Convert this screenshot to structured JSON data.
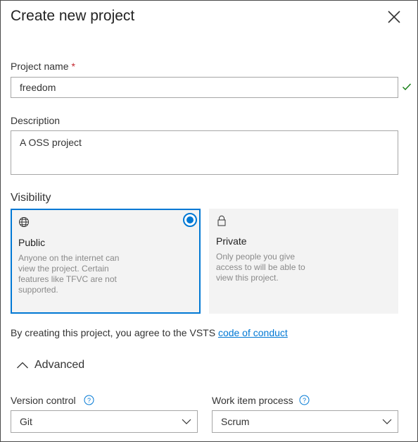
{
  "dialog": {
    "title": "Create new project",
    "close_icon": "close-icon"
  },
  "project_name": {
    "label": "Project name",
    "required_marker": "*",
    "value": "freedom",
    "valid_icon": "checkmark-icon"
  },
  "description": {
    "label": "Description",
    "value": "A OSS project"
  },
  "visibility": {
    "label": "Visibility",
    "options": [
      {
        "icon": "globe-icon",
        "title": "Public",
        "description": "Anyone on the internet can view the project. Certain features like TFVC are not supported.",
        "selected": true
      },
      {
        "icon": "lock-icon",
        "title": "Private",
        "description": "Only people you give access to will be able to view this project.",
        "selected": false
      }
    ]
  },
  "terms": {
    "text": "By creating this project, you agree to the VSTS ",
    "link": "code of conduct"
  },
  "advanced": {
    "label": "Advanced",
    "icon": "chevron-up-icon"
  },
  "version_control": {
    "label": "Version control",
    "help_icon": "help-icon",
    "value": "Git"
  },
  "work_item_process": {
    "label": "Work item process",
    "help_icon": "help-icon",
    "value": "Scrum"
  },
  "colors": {
    "accent": "#0078d4",
    "required": "#c4262e",
    "valid": "#107c10",
    "card_bg": "#f3f3f3"
  }
}
